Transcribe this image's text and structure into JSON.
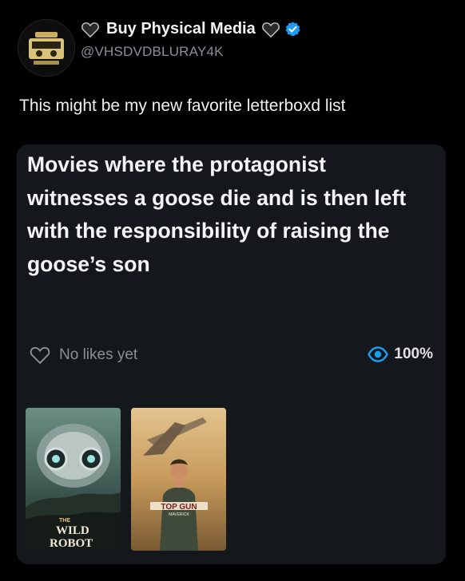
{
  "user": {
    "display_name": "Buy Physical Media",
    "handle": "@VHSDVDBLURAY4K",
    "avatar_icon": "vhs-tape-logo-icon",
    "verified": true
  },
  "post": {
    "text": "This might be my new favorite letterboxd list"
  },
  "list_card": {
    "title": "Movies where the protagonist witnesses a goose die and is then left with the responsibility of raising the goose’s son",
    "likes_text": "No likes yet",
    "views_text": "100%",
    "posters": [
      {
        "title_line1": "THE",
        "title_line2": "WILD",
        "title_line3": "ROBOT"
      },
      {
        "title": "TOP GUN",
        "subtitle": "MAVERICK"
      }
    ]
  },
  "colors": {
    "background": "#000000",
    "card": "#14181d",
    "accent": "#1d9bf0",
    "muted": "#8b9096"
  }
}
